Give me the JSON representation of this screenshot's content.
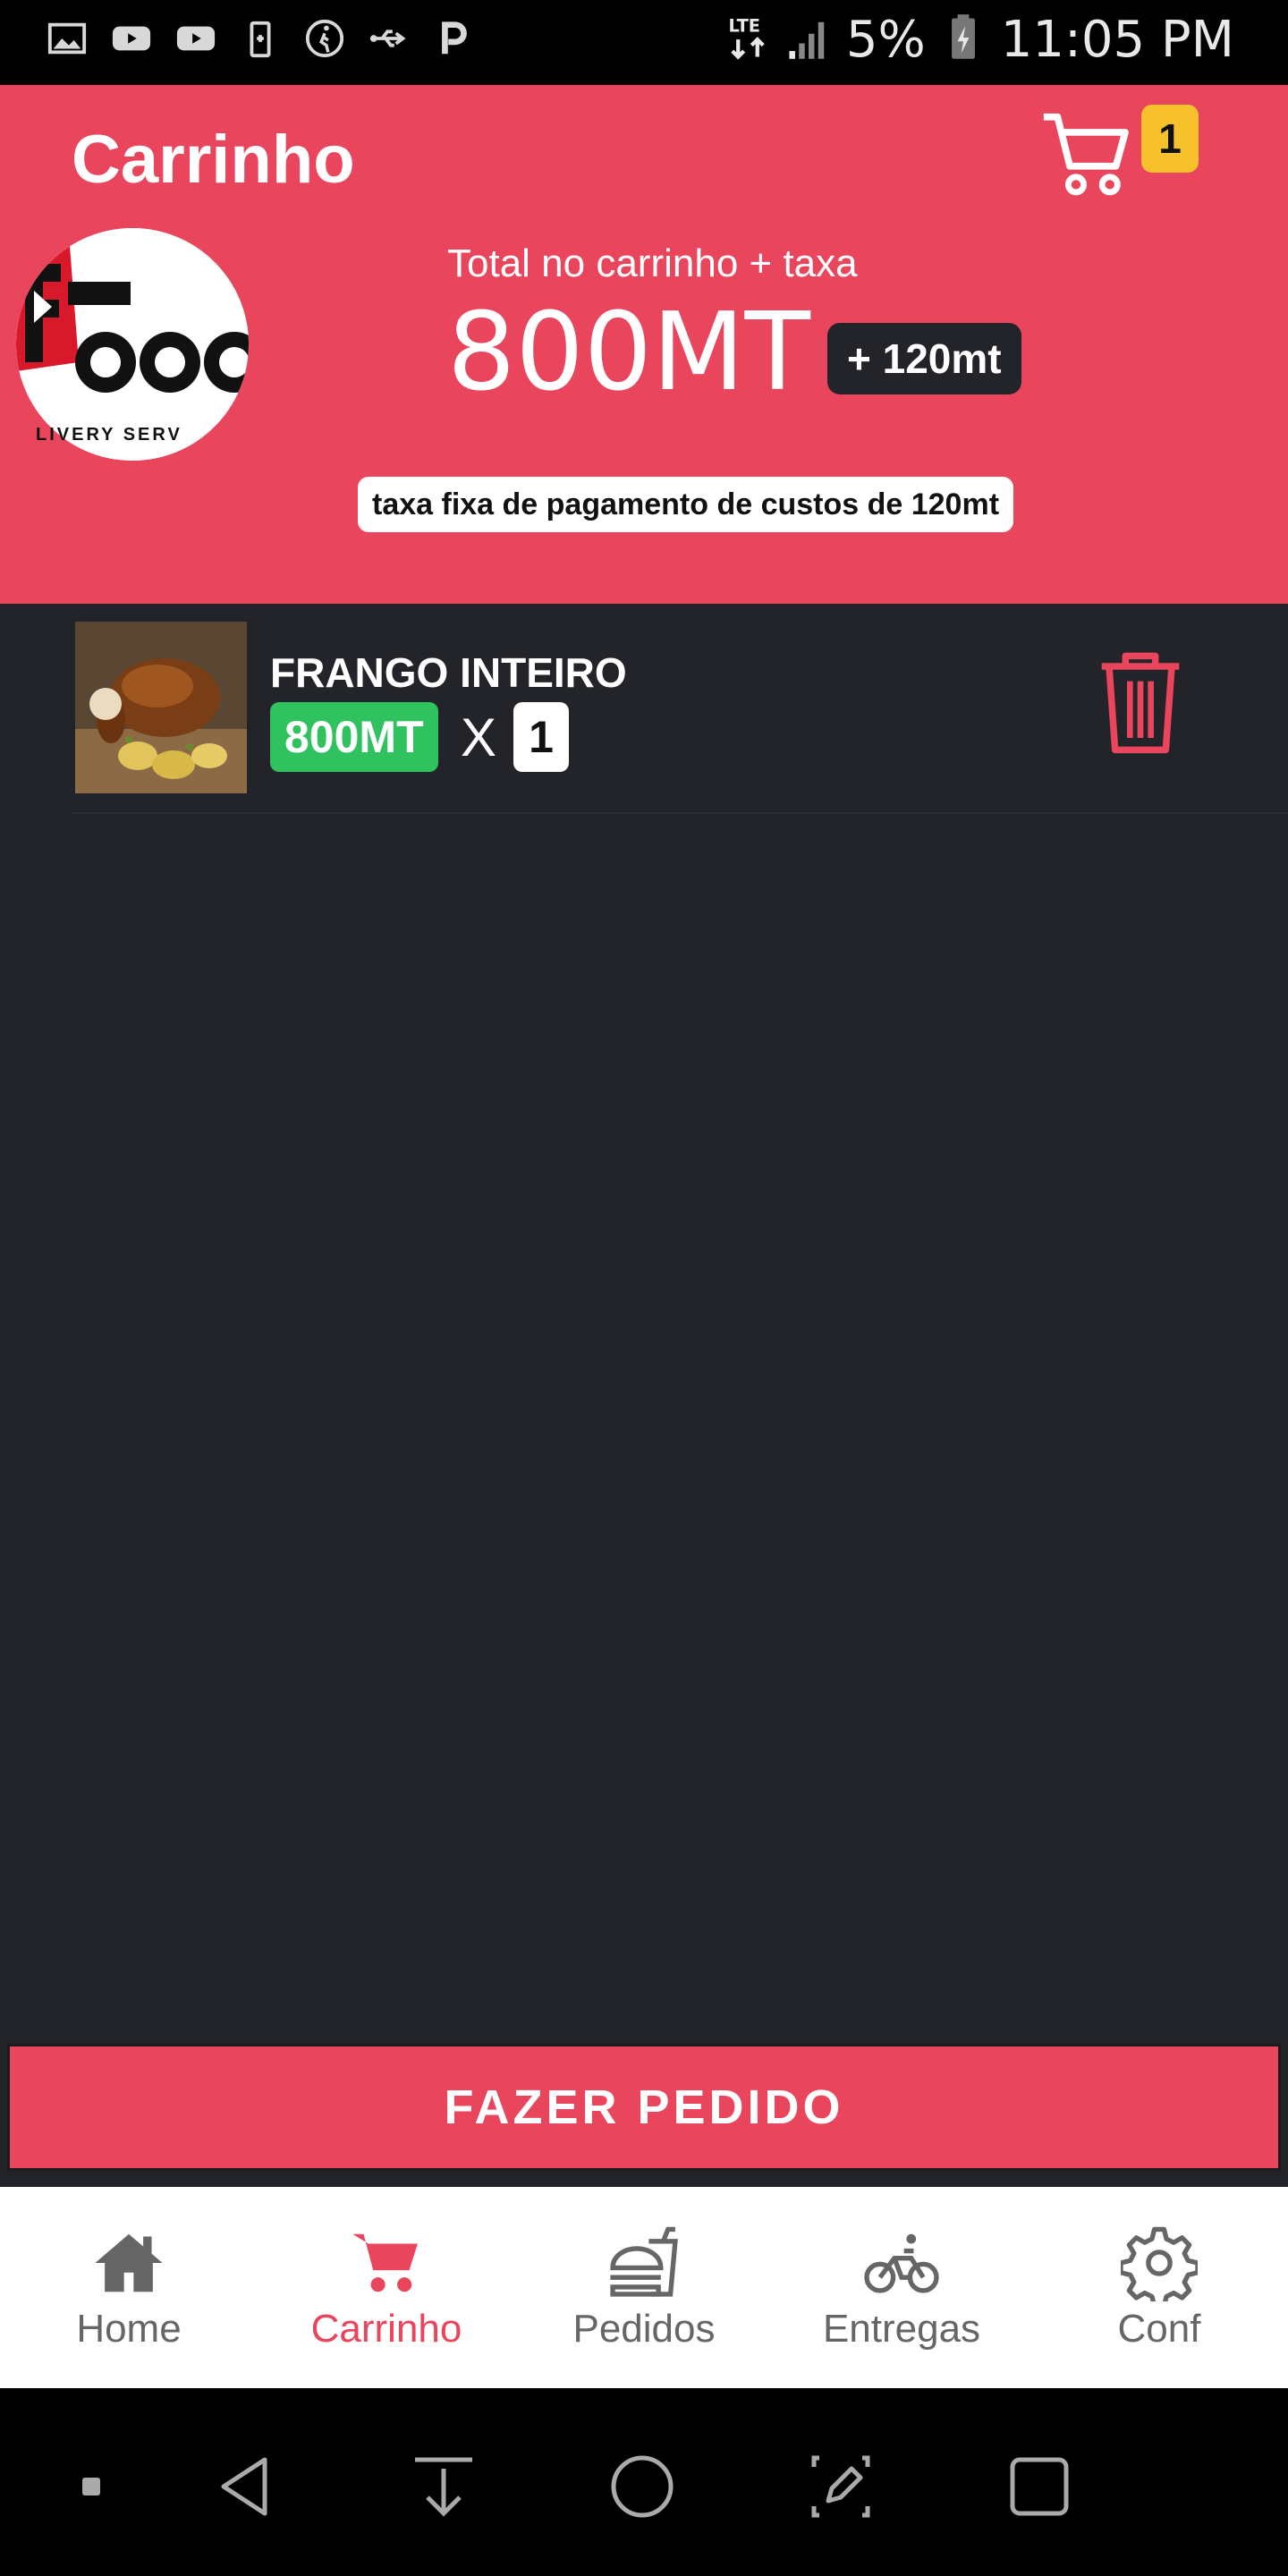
{
  "status_bar": {
    "battery": "5%",
    "time": "11:05 PM",
    "network": "LTE"
  },
  "header": {
    "title": "Carrinho",
    "cart_count": "1",
    "total_label": "Total no carrinho + taxa",
    "total_value": "800MT",
    "fee_badge": "+ 120mt",
    "fee_note": "taxa fixa de pagamento de custos de 120mt",
    "logo_text": "LIVERY SERV"
  },
  "cart": {
    "items": [
      {
        "name": "FRANGO INTEIRO",
        "price": "800MT",
        "times": "X",
        "quantity": "1"
      }
    ]
  },
  "order_button": {
    "label": "FAZER PEDIDO"
  },
  "tabs": [
    {
      "label": "Home",
      "icon": "home-icon"
    },
    {
      "label": "Carrinho",
      "icon": "cart-icon",
      "active": true
    },
    {
      "label": "Pedidos",
      "icon": "burger-drink-icon"
    },
    {
      "label": "Entregas",
      "icon": "bicycle-icon"
    },
    {
      "label": "Conf",
      "icon": "gear-icon"
    }
  ],
  "colors": {
    "accent": "#e9455c",
    "background": "#232429",
    "price_green": "#2fc25e",
    "badge_yellow": "#f7c12b"
  }
}
